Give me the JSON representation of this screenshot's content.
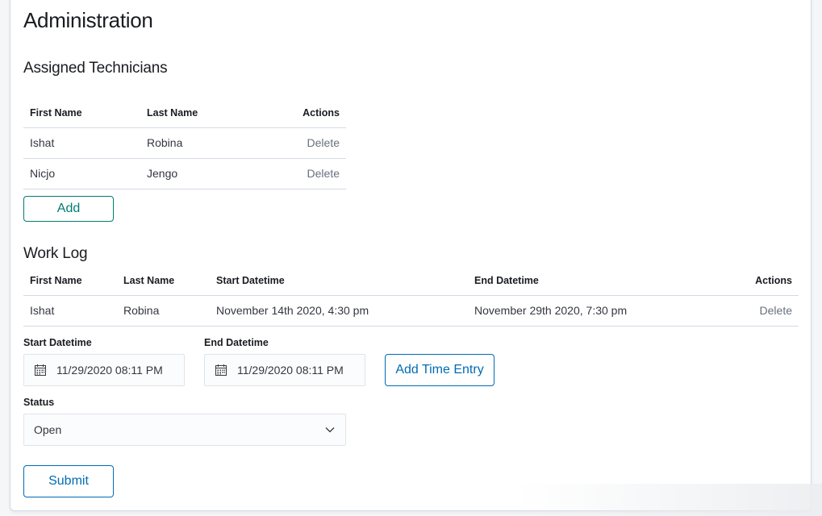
{
  "page": {
    "title": "Administration"
  },
  "technicians": {
    "title": "Assigned Technicians",
    "headers": {
      "first": "First Name",
      "last": "Last Name",
      "actions": "Actions"
    },
    "rows": [
      {
        "first": "Ishat",
        "last": "Robina",
        "action": "Delete"
      },
      {
        "first": "Nicjo",
        "last": "Jengo",
        "action": "Delete"
      }
    ],
    "add_label": "Add"
  },
  "worklog": {
    "title": "Work Log",
    "headers": {
      "first": "First Name",
      "last": "Last Name",
      "start": "Start Datetime",
      "end": "End Datetime",
      "actions": "Actions"
    },
    "rows": [
      {
        "first": "Ishat",
        "last": "Robina",
        "start": "November 14th 2020, 4:30 pm",
        "end": "November 29th 2020, 7:30 pm",
        "action": "Delete"
      }
    ],
    "start_label": "Start Datetime",
    "start_value": "11/29/2020 08:11 PM",
    "end_label": "End Datetime",
    "end_value": "11/29/2020 08:11 PM",
    "add_time_label": "Add Time Entry"
  },
  "status": {
    "label": "Status",
    "value": "Open"
  },
  "submit_label": "Submit",
  "colors": {
    "teal": "#017d73",
    "blue": "#006bb4",
    "border": "#d3dae6"
  }
}
